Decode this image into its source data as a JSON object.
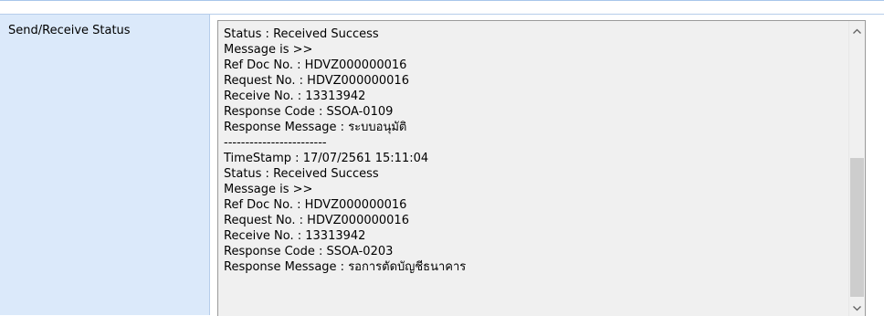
{
  "field": {
    "label": "Send/Receive Status"
  },
  "log": {
    "lines": [
      "Status : Received Success",
      "Message is >>",
      "Ref Doc No. : HDVZ000000016",
      "Request No. : HDVZ000000016",
      "Receive No. : 13313942",
      "Response Code : SSOA-0109",
      "Response Message : ระบบอนุมัติ",
      "------------------------",
      "TimeStamp : 17/07/2561 15:11:04",
      "Status : Received Success",
      "Message is >>",
      "Ref Doc No. : HDVZ000000016",
      "Request No. : HDVZ000000016",
      "Receive No. : 13313942",
      "Response Code : SSOA-0203",
      "Response Message : รอการตัดบัญชีธนาคาร"
    ]
  },
  "scrollbar": {
    "up_icon": "chevron-up-icon",
    "down_icon": "chevron-down-icon",
    "position_fraction": 0.6
  },
  "colors": {
    "label_background": "#dbe9fa",
    "textarea_background": "#f0f0f0",
    "scroll_thumb": "#cdcdcd"
  }
}
